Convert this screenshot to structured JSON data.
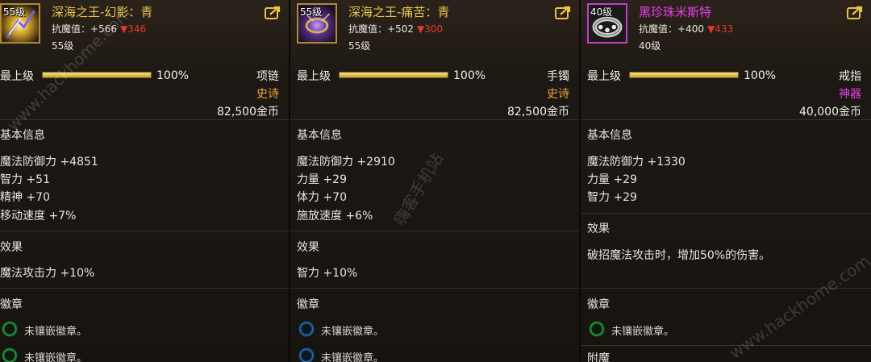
{
  "panels": [
    {
      "level_badge": "55级",
      "name": "深海之王-幻影：青",
      "resist_label": "抗魔值：",
      "resist_up": "+566",
      "resist_down": "▼346",
      "level_text": "55级",
      "quality_label": "最上级",
      "quality_percent": "100%",
      "quality_fill": 1.0,
      "slot": "项链",
      "rarity": "史诗",
      "price": "82,500金币",
      "basic_header": "基本信息",
      "stats": [
        "魔法防御力 +4851",
        "智力 +51",
        "精神 +70",
        "移动速度 +7%"
      ],
      "effect_header": "效果",
      "effect": "魔法攻击力 +10%",
      "badge_header": "徽章",
      "badges": [
        "未镶嵌徽章。",
        "未镶嵌徽章。"
      ]
    },
    {
      "level_badge": "55级",
      "name": "深海之王-痛苦：青",
      "resist_label": "抗魔值：",
      "resist_up": "+502",
      "resist_down": "▼300",
      "level_text": "55级",
      "quality_label": "最上级",
      "quality_percent": "100%",
      "quality_fill": 1.0,
      "slot": "手镯",
      "rarity": "史诗",
      "price": "82,500金币",
      "basic_header": "基本信息",
      "stats": [
        "魔法防御力 +2910",
        "力量 +29",
        "体力 +70",
        "施放速度 +6%"
      ],
      "effect_header": "效果",
      "effect": "智力 +10%",
      "badge_header": "徽章",
      "badges": [
        "未镶嵌徽章。",
        "未镶嵌徽章。"
      ]
    },
    {
      "level_badge": "40级",
      "name": "黑珍珠米斯特",
      "resist_label": "抗魔值：",
      "resist_up": "+400",
      "resist_down": "▼433",
      "level_text": "40级",
      "quality_label": "最上级",
      "quality_percent": "100%",
      "quality_fill": 1.0,
      "slot": "戒指",
      "rarity": "神器",
      "price": "40,000金币",
      "basic_header": "基本信息",
      "stats": [
        "魔法防御力 +1330",
        "力量 +29",
        "智力 +29"
      ],
      "effect_header": "效果",
      "effect": "破招魔法攻击时，增加50%的伤害。",
      "badge_header": "徽章",
      "badges": [
        "未镶嵌徽章。"
      ],
      "enchant_header": "附魔"
    }
  ],
  "watermarks": [
    "www.hackhome.com",
    "嗨客手机站",
    "www.hackhome.com"
  ],
  "colors": {
    "epic": "#f2a33a",
    "artifact": "#e93fe6",
    "gold_title": "#e7c54a",
    "resist_down": "#e23a2d"
  },
  "icons": [
    "necklace-item-icon",
    "bracelet-item-icon",
    "ring-item-icon",
    "share-edit-icon",
    "badge-slot-icon"
  ]
}
